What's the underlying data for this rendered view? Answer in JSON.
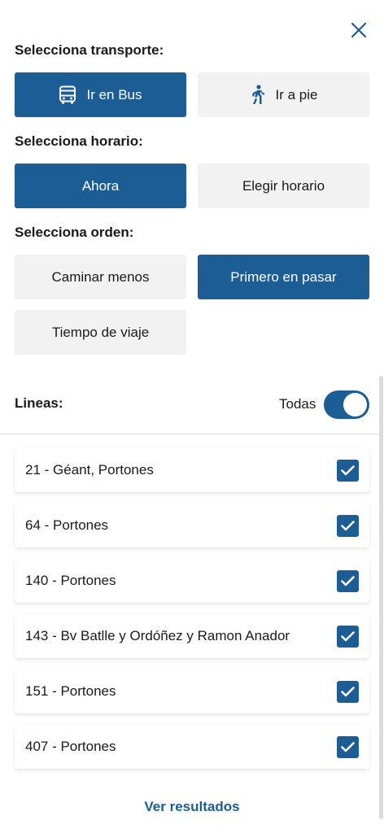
{
  "transport": {
    "heading": "Selecciona transporte:",
    "bus_label": "Ir en Bus",
    "walk_label": "Ir a pie",
    "selected": "bus"
  },
  "schedule": {
    "heading": "Selecciona horario:",
    "now_label": "Ahora",
    "choose_label": "Elegir horario",
    "selected": "now"
  },
  "order": {
    "heading": "Selecciona orden:",
    "walk_less_label": "Caminar menos",
    "first_label": "Primero en pasar",
    "travel_time_label": "Tiempo de viaje",
    "selected": "first"
  },
  "lines": {
    "heading": "Lineas:",
    "all_label": "Todas",
    "all_enabled": true,
    "items": [
      {
        "label": "21 - Géant, Portones",
        "checked": true
      },
      {
        "label": "64 - Portones",
        "checked": true
      },
      {
        "label": "140 - Portones",
        "checked": true
      },
      {
        "label": "143 - Bv Batlle y Ordóñez y Ramon Anador",
        "checked": true
      },
      {
        "label": "151 - Portones",
        "checked": true
      },
      {
        "label": "407 - Portones",
        "checked": true
      }
    ]
  },
  "results_label": "Ver resultados",
  "colors": {
    "accent": "#1c5d95",
    "unselected_bg": "#f2f2f2"
  },
  "icons": {
    "close": "close-icon",
    "bus": "bus-icon",
    "walk": "walking-person-icon",
    "check": "checkmark-icon"
  }
}
